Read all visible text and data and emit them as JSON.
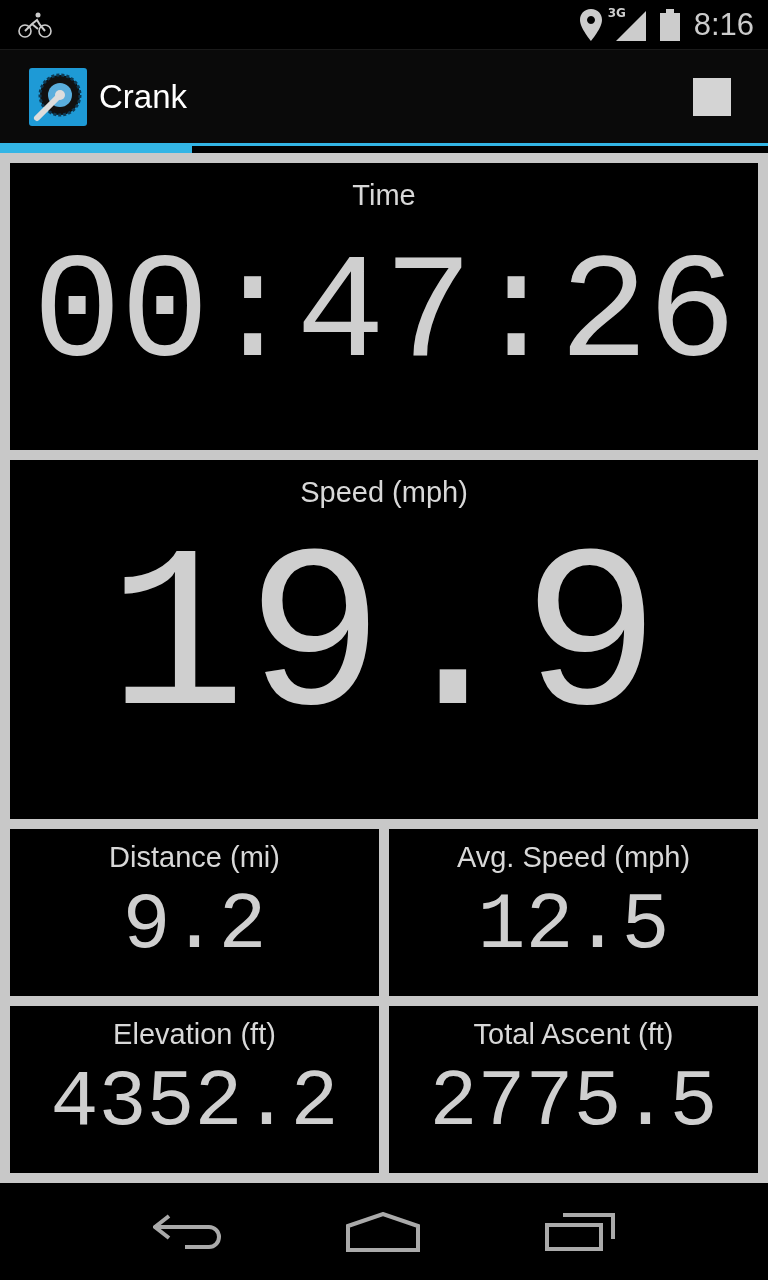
{
  "status_bar": {
    "network": "3G",
    "time": "8:16"
  },
  "action_bar": {
    "title": "Crank"
  },
  "progress": {
    "level": 0.25
  },
  "main": {
    "label": "Time",
    "value": "00:47:26"
  },
  "speed": {
    "label": "Speed (mph)",
    "value": "19.9"
  },
  "stats": [
    {
      "label": "Distance (mi)",
      "value": "9.2"
    },
    {
      "label": "Avg. Speed (mph)",
      "value": "12.5"
    },
    {
      "label": "Elevation (ft)",
      "value": "4352.2"
    },
    {
      "label": "Total Ascent (ft)",
      "value": "2775.5"
    }
  ]
}
